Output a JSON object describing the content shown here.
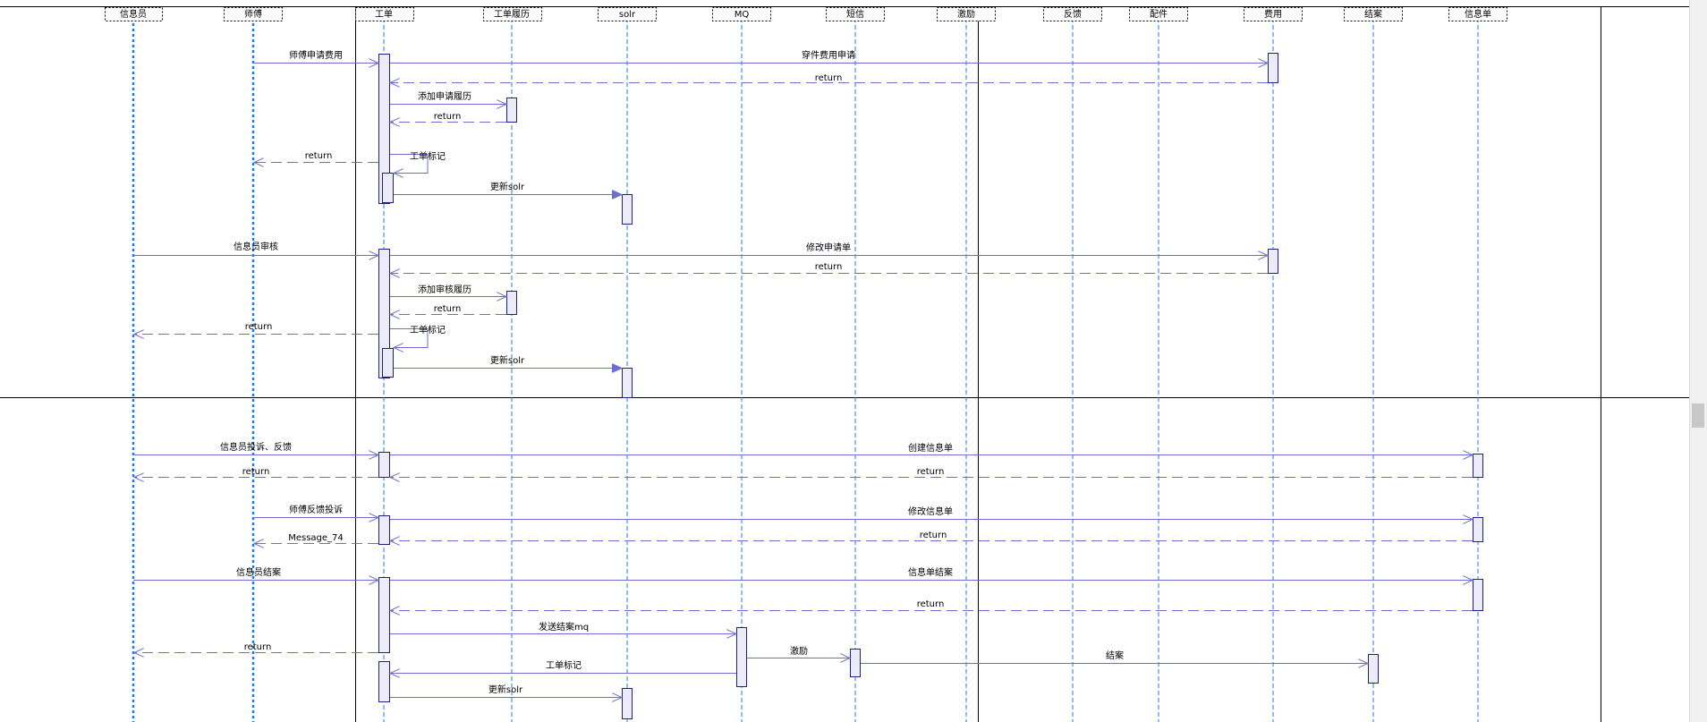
{
  "lifelines": [
    {
      "id": "xinxiyuan",
      "label": "信息员"
    },
    {
      "id": "shifu",
      "label": "师傅"
    },
    {
      "id": "gongdan",
      "label": "工单"
    },
    {
      "id": "gongdanlvli",
      "label": "工单履历"
    },
    {
      "id": "solr",
      "label": "solr"
    },
    {
      "id": "mq",
      "label": "MQ"
    },
    {
      "id": "duanxin",
      "label": "短信"
    },
    {
      "id": "jili",
      "label": "激励"
    },
    {
      "id": "fankui",
      "label": "反馈"
    },
    {
      "id": "peijian",
      "label": "配件"
    },
    {
      "id": "feiyong",
      "label": "费用"
    },
    {
      "id": "jiean",
      "label": "结案"
    },
    {
      "id": "xinxidan",
      "label": "信息单"
    }
  ],
  "messages": [
    {
      "label": "师傅申请费用"
    },
    {
      "label": "穿件费用申请"
    },
    {
      "label": "return"
    },
    {
      "label": "添加申请履历"
    },
    {
      "label": "return"
    },
    {
      "label": "return"
    },
    {
      "label": "工单标记"
    },
    {
      "label": "更新solr"
    },
    {
      "label": "信息员审核"
    },
    {
      "label": "修改申请单"
    },
    {
      "label": "return"
    },
    {
      "label": "添加审核履历"
    },
    {
      "label": "return"
    },
    {
      "label": "return"
    },
    {
      "label": "工单标记"
    },
    {
      "label": "更新solr"
    },
    {
      "label": "信息员投诉、反馈"
    },
    {
      "label": "创建信息单"
    },
    {
      "label": "return"
    },
    {
      "label": "return"
    },
    {
      "label": "师傅反馈投诉"
    },
    {
      "label": "修改信息单"
    },
    {
      "label": "Message_74"
    },
    {
      "label": "return"
    },
    {
      "label": "信息员结案"
    },
    {
      "label": "信息单结案"
    },
    {
      "label": "return"
    },
    {
      "label": "发送结案mq"
    },
    {
      "label": "return"
    },
    {
      "label": "激励"
    },
    {
      "label": "结案"
    },
    {
      "label": "工单标记"
    },
    {
      "label": "更新solr"
    }
  ]
}
